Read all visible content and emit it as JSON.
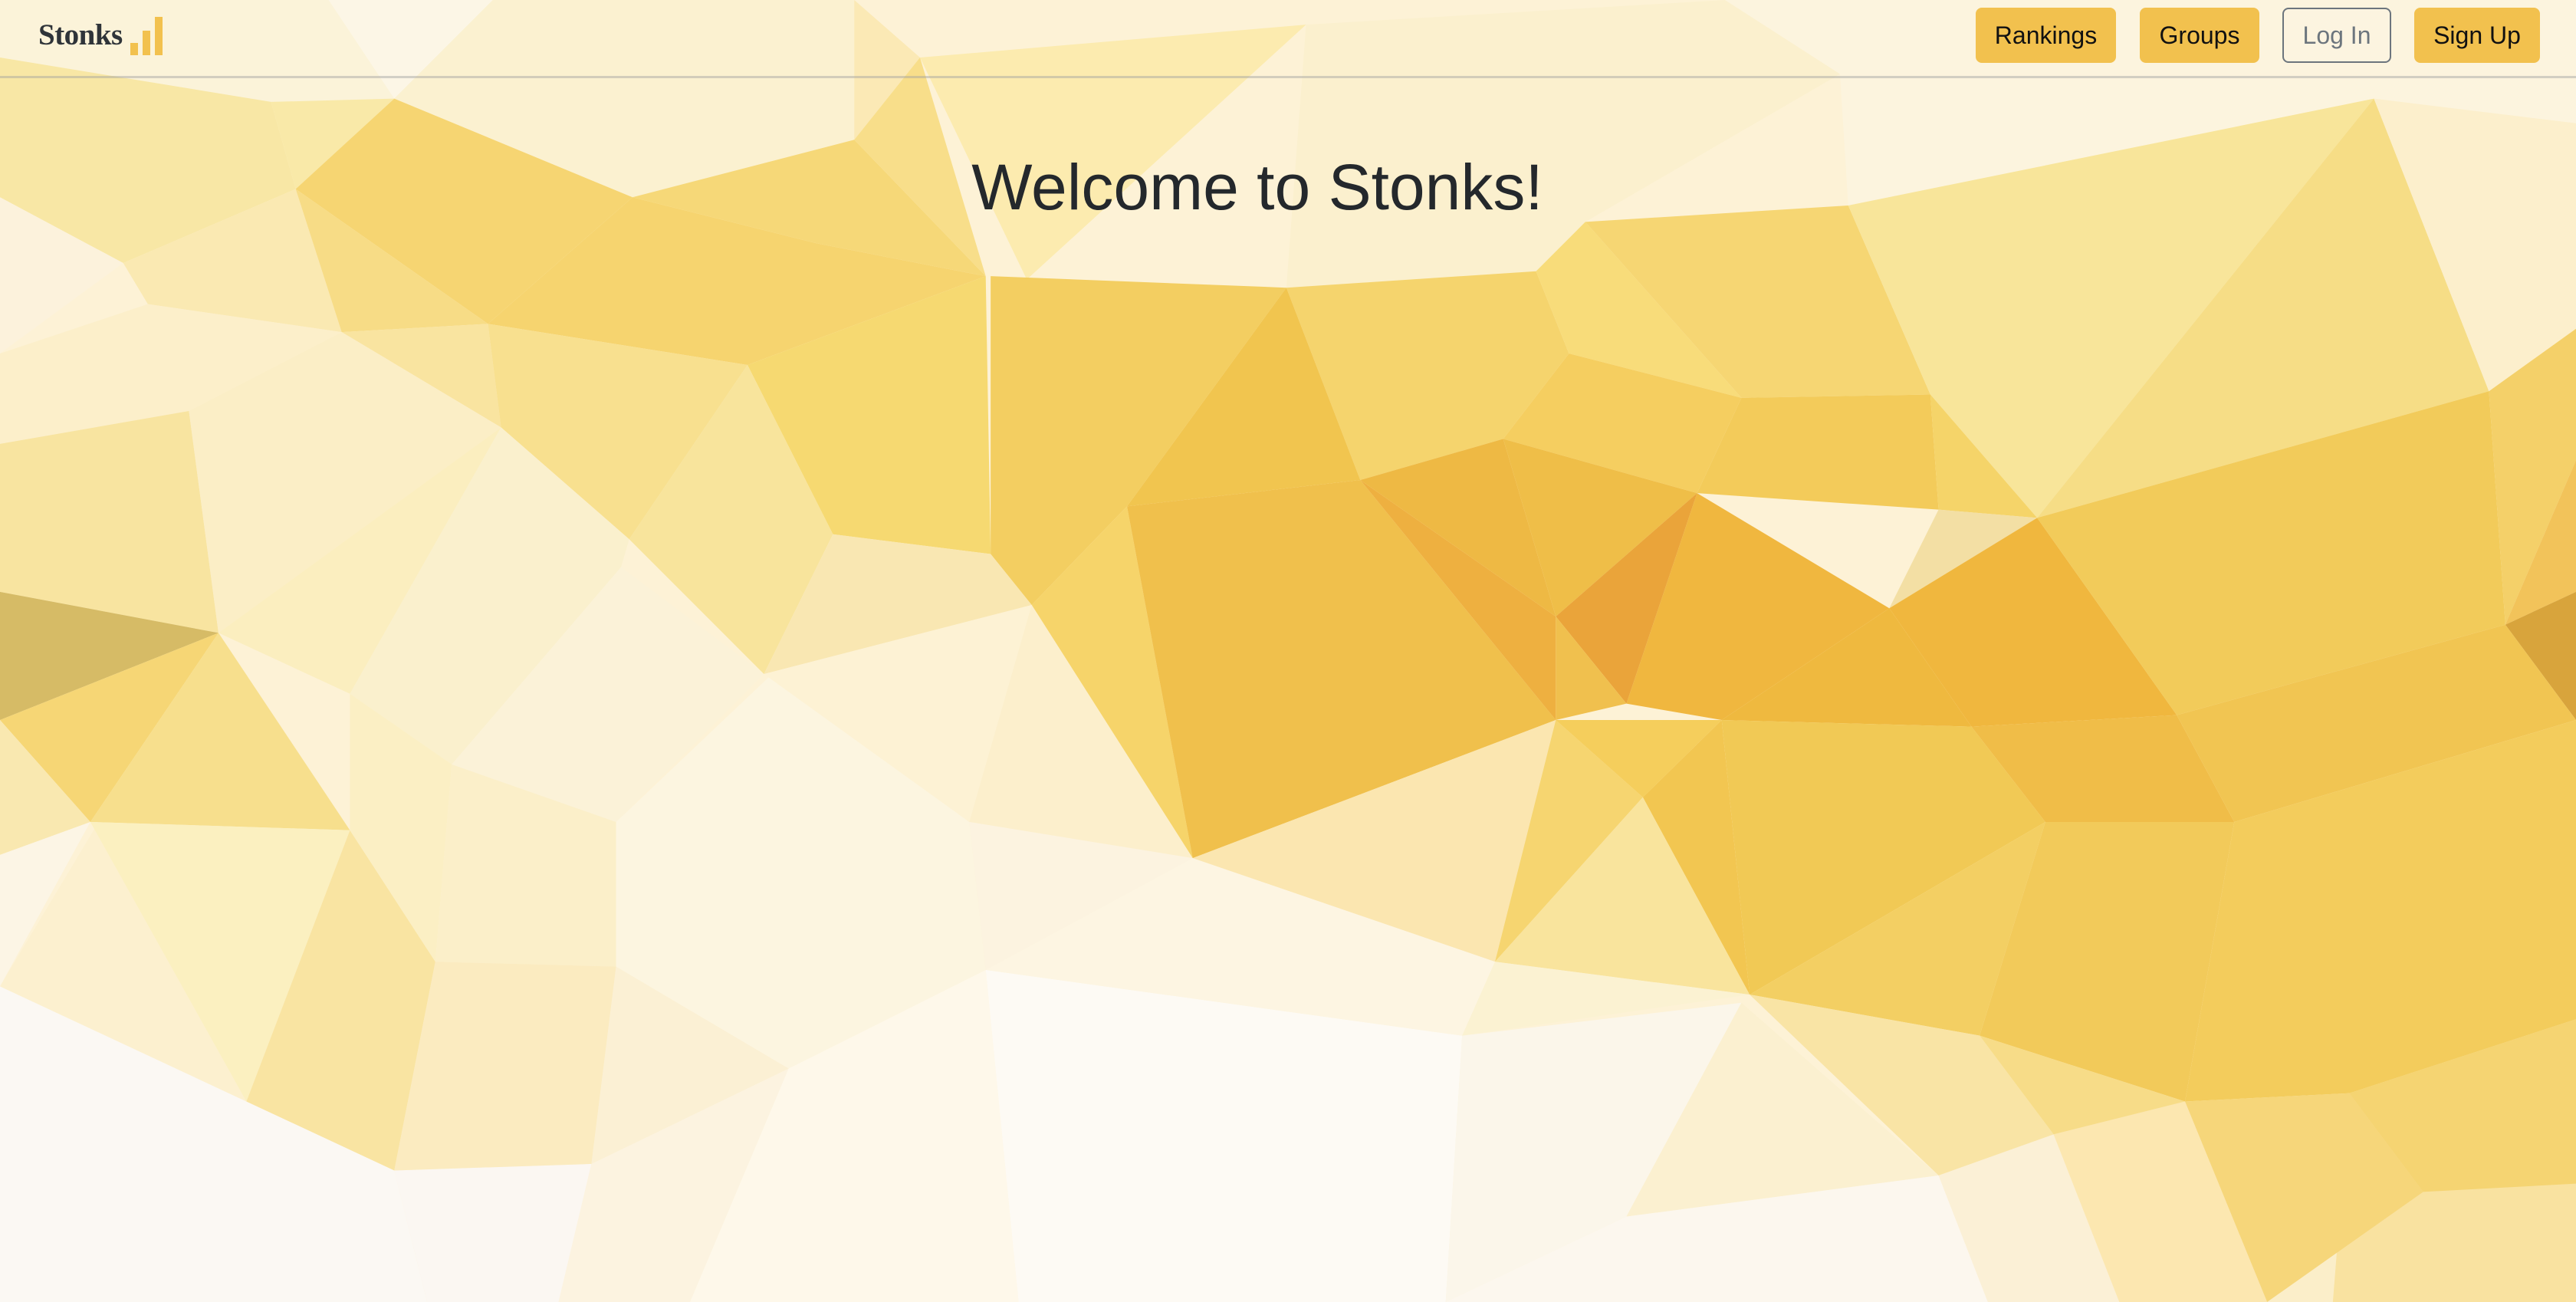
{
  "navbar": {
    "brand": "Stonks",
    "buttons": {
      "rankings": "Rankings",
      "groups": "Groups",
      "login": "Log In",
      "signup": "Sign Up"
    }
  },
  "hero": {
    "title": "Welcome to Stonks!"
  },
  "colors": {
    "accent": "#f2c14e",
    "text": "#24282c",
    "outline": "#6c757d"
  }
}
